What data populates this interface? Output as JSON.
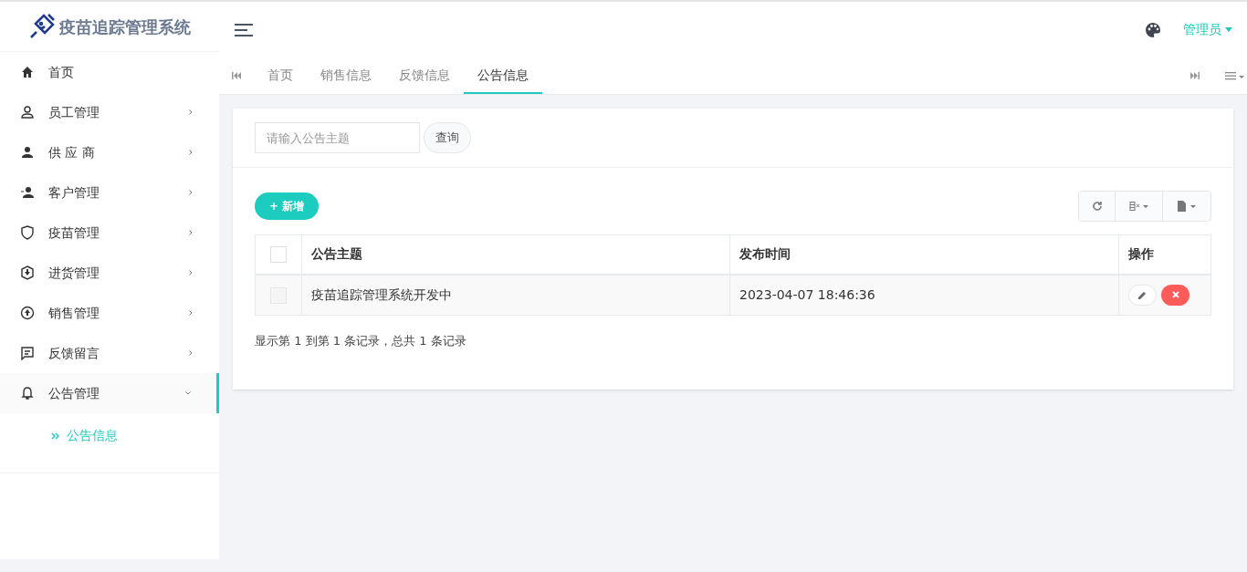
{
  "logo": {
    "title": "疫苗追踪管理系统"
  },
  "sidebar": {
    "items": [
      {
        "label": "首页",
        "selected": false
      },
      {
        "label": "员工管理",
        "expanded": false,
        "selected": false
      },
      {
        "label": "供 应 商",
        "expanded": false,
        "selected": false
      },
      {
        "label": "客户管理",
        "expanded": false,
        "selected": false
      },
      {
        "label": "疫苗管理",
        "expanded": false,
        "selected": false
      },
      {
        "label": "进货管理",
        "expanded": false,
        "selected": false
      },
      {
        "label": "销售管理",
        "expanded": false,
        "selected": false
      },
      {
        "label": "反馈留言",
        "expanded": false,
        "selected": false
      },
      {
        "label": "公告管理",
        "expanded": true,
        "selected": true,
        "children": [
          {
            "label": "公告信息",
            "selected": true
          }
        ]
      }
    ]
  },
  "header": {
    "user": "管理员"
  },
  "tabs": [
    {
      "label": "首页",
      "selected": false
    },
    {
      "label": "销售信息",
      "selected": false
    },
    {
      "label": "反馈信息",
      "selected": false
    },
    {
      "label": "公告信息",
      "selected": true
    }
  ],
  "search": {
    "placeholder": "请输入公告主题",
    "button": "查询"
  },
  "add_button": "+ 新增",
  "table": {
    "all_checked": false,
    "columns": [
      "公告主题",
      "发布时间",
      "操作"
    ],
    "rows": [
      {
        "checked": false,
        "subject": "疫苗追踪管理系统开发中",
        "time": "2023-04-07 18:46:36"
      }
    ]
  },
  "pagination": "显示第 1 到第 1 条记录，总共 1 条记录"
}
